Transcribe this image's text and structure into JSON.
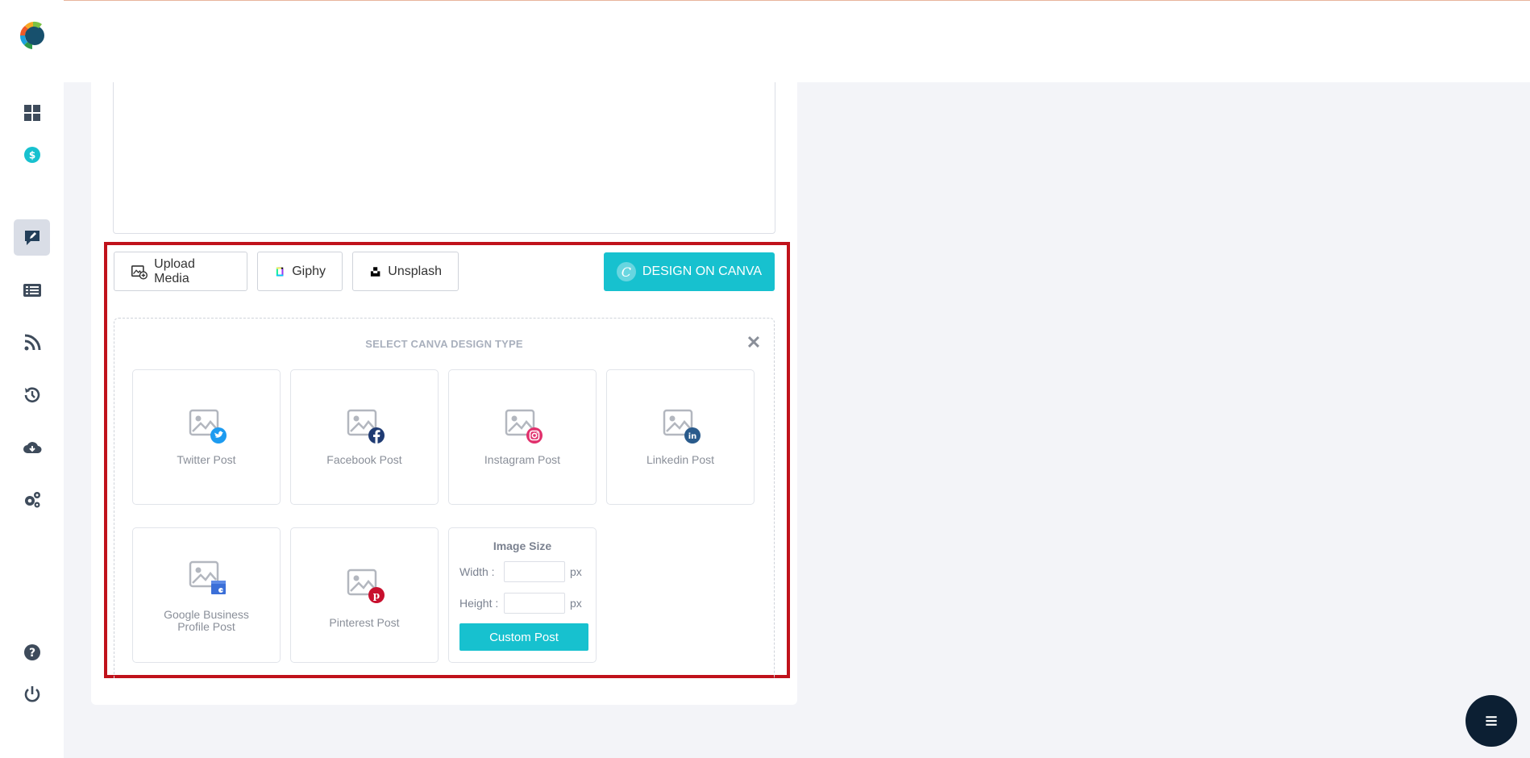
{
  "sidebar": {
    "items": [
      {
        "name": "dashboard-icon"
      },
      {
        "name": "pricing-icon"
      },
      {
        "name": "compose-post-icon",
        "active": true
      },
      {
        "name": "posts-list-icon"
      },
      {
        "name": "rss-feed-icon"
      },
      {
        "name": "history-icon"
      },
      {
        "name": "cloud-download-icon"
      },
      {
        "name": "settings-icon"
      },
      {
        "name": "help-icon"
      },
      {
        "name": "logout-icon"
      }
    ]
  },
  "media_toolbar": {
    "upload_label": "Upload Media",
    "giphy_label": "Giphy",
    "unsplash_label": "Unsplash",
    "canva_label": "DESIGN ON CANVA",
    "canva_logo_letter": "C"
  },
  "canva_panel": {
    "title": "SELECT CANVA DESIGN TYPE",
    "close_symbol": "✕",
    "design_types": [
      {
        "label": "Twitter Post",
        "badge_color": "#1d9bf0"
      },
      {
        "label": "Facebook Post",
        "badge_color": "#1f3b73"
      },
      {
        "label": "Instagram Post",
        "badge_color": "#e1306c"
      },
      {
        "label": "Linkedin Post",
        "badge_color": "#2a5b8c"
      },
      {
        "label_line1": "Google Business",
        "label_line2": "Profile Post",
        "badge_color": "#3b6fd8"
      },
      {
        "label": "Pinterest Post",
        "badge_color": "#c8102e"
      }
    ],
    "custom_size": {
      "title": "Image Size",
      "width_label": "Width :",
      "height_label": "Height :",
      "unit": "px",
      "width_value": "",
      "height_value": "",
      "button_label": "Custom Post"
    }
  },
  "colors": {
    "accent": "#17c1cf",
    "highlight_border": "#c0121b",
    "fab": "#0c1f33"
  }
}
